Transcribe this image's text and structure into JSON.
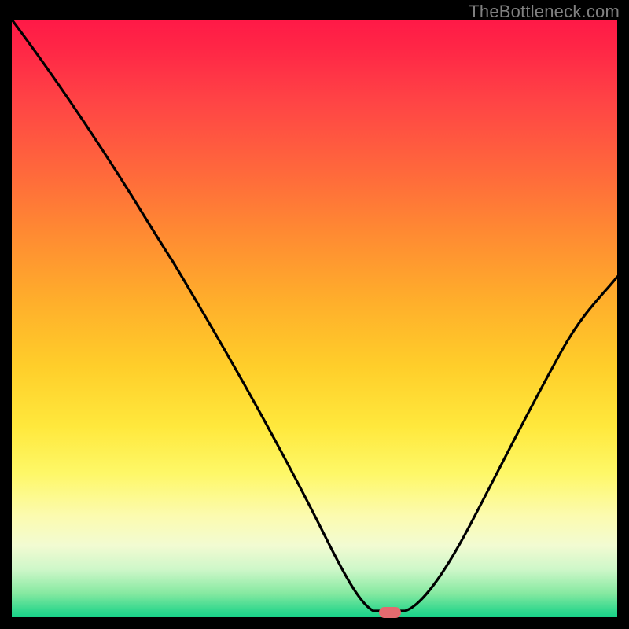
{
  "watermark": "TheBottleneck.com",
  "marker": {
    "x_pct": 62.5,
    "y_pct": 99.2,
    "color": "#e46a6f"
  },
  "chart_data": {
    "type": "line",
    "title": "",
    "xlabel": "",
    "ylabel": "",
    "xlim": [
      0,
      100
    ],
    "ylim": [
      0,
      100
    ],
    "grid": false,
    "legend": false,
    "annotations": [],
    "series": [
      {
        "name": "bottleneck-curve",
        "x": [
          0,
          5,
          10,
          15,
          20,
          25,
          30,
          35,
          40,
          45,
          50,
          55,
          58,
          60,
          62,
          64,
          66,
          70,
          75,
          80,
          85,
          90,
          95,
          100
        ],
        "values": [
          100,
          94,
          88,
          82,
          76,
          69,
          63,
          54,
          44,
          33,
          22,
          11,
          4,
          1,
          0.5,
          0.5,
          2,
          7,
          15,
          24,
          33,
          42,
          50,
          57
        ]
      }
    ],
    "optimum": {
      "x": 62.5,
      "value": 0.5
    }
  }
}
